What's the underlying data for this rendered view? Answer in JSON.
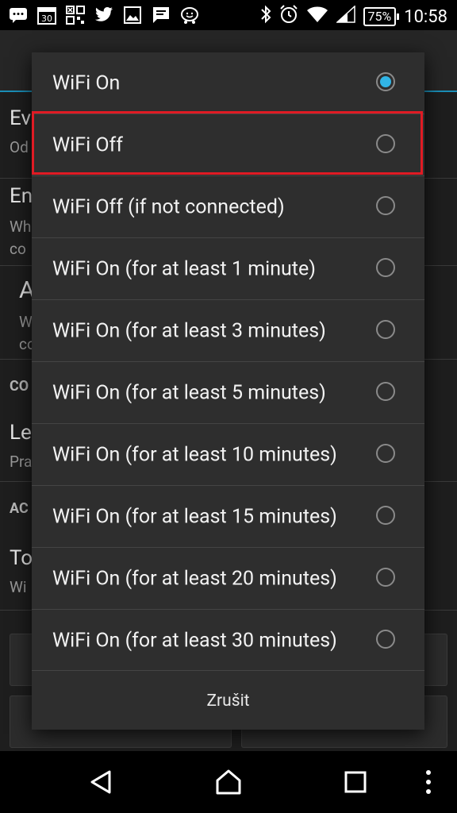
{
  "status_bar": {
    "calendar_day": "30",
    "battery": "75%",
    "time": "10:58",
    "icons": [
      "chat-icon",
      "calendar-icon",
      "qr-icon",
      "twitter-icon",
      "image-icon",
      "message-icon",
      "waze-icon",
      "bluetooth-icon",
      "alarm-icon",
      "wifi-icon",
      "signal-icon",
      "battery-icon"
    ]
  },
  "background": {
    "rows": [
      {
        "title": "Ev",
        "sub": "Od"
      },
      {
        "title": "En",
        "sub": "Wh"
      },
      {
        "title": "",
        "sub": "co"
      },
      {
        "title": "A",
        "sub": "W"
      },
      {
        "title": "",
        "sub": "co"
      },
      {
        "section": "CO"
      },
      {
        "title": "Le",
        "sub": "Pra"
      },
      {
        "section": "AC"
      },
      {
        "title": "To",
        "sub": "Wi"
      }
    ]
  },
  "dialog": {
    "options": [
      {
        "label": "WiFi On",
        "checked": true
      },
      {
        "label": "WiFi Off",
        "checked": false
      },
      {
        "label": "WiFi Off (if not connected)",
        "checked": false
      },
      {
        "label": "WiFi On (for at least 1 minute)",
        "checked": false
      },
      {
        "label": "WiFi On (for at least 3 minutes)",
        "checked": false
      },
      {
        "label": "WiFi On (for at least 5 minutes)",
        "checked": false
      },
      {
        "label": "WiFi On (for at least 10 minutes)",
        "checked": false
      },
      {
        "label": "WiFi On (for at least 15 minutes)",
        "checked": false
      },
      {
        "label": "WiFi On (for at least 20 minutes)",
        "checked": false
      },
      {
        "label": "WiFi On (for at least 30 minutes)",
        "checked": false
      }
    ],
    "cancel_label": "Zrušit"
  },
  "colors": {
    "accent": "#31b5e6",
    "highlight": "#e01b24",
    "dialog_bg": "#2e2e2e"
  }
}
